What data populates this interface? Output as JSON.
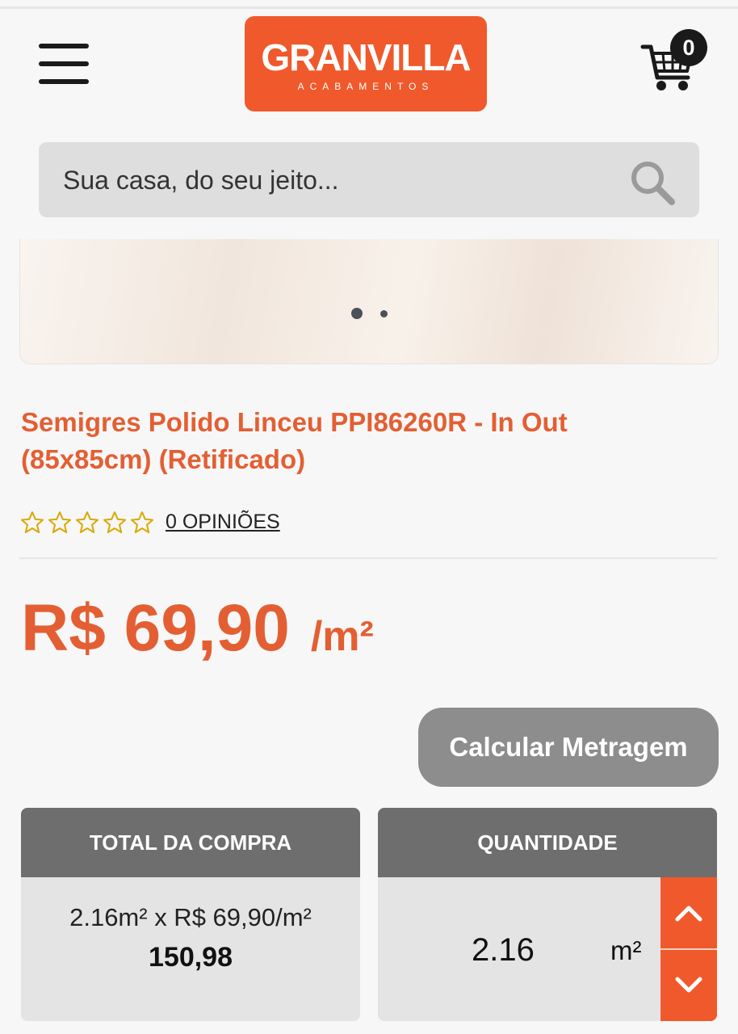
{
  "header": {
    "menu_icon": "hamburger-menu-icon",
    "logo": {
      "name": "GRANVILLA",
      "tagline": "ACABAMENTOS",
      "color": "#f0592b"
    },
    "cart": {
      "icon": "shopping-cart-icon",
      "count": "0"
    }
  },
  "search": {
    "placeholder": "Sua casa, do seu jeito...",
    "icon": "search-icon"
  },
  "carousel": {
    "dots": 2,
    "active_index": 0
  },
  "product": {
    "title": "Semigres Polido Linceu PPI86260R - In Out (85x85cm) (Retificado)",
    "rating": {
      "stars_filled": 0,
      "stars_total": 5,
      "reviews_label": "0 OPINIÕES"
    },
    "price": {
      "value": "R$ 69,90",
      "unit": "/m²"
    },
    "accent_color": "#e35f33"
  },
  "calc_button": {
    "label": "Calcular Metragem"
  },
  "total_panel": {
    "header": "TOTAL DA COMPRA",
    "calc_line": "2.16m² x R$ 69,90/m²",
    "total": "150,98"
  },
  "quantity_panel": {
    "header": "QUANTIDADE",
    "value": "2.16",
    "unit": "m²",
    "up_icon": "chevron-up-icon",
    "down_icon": "chevron-down-icon"
  }
}
